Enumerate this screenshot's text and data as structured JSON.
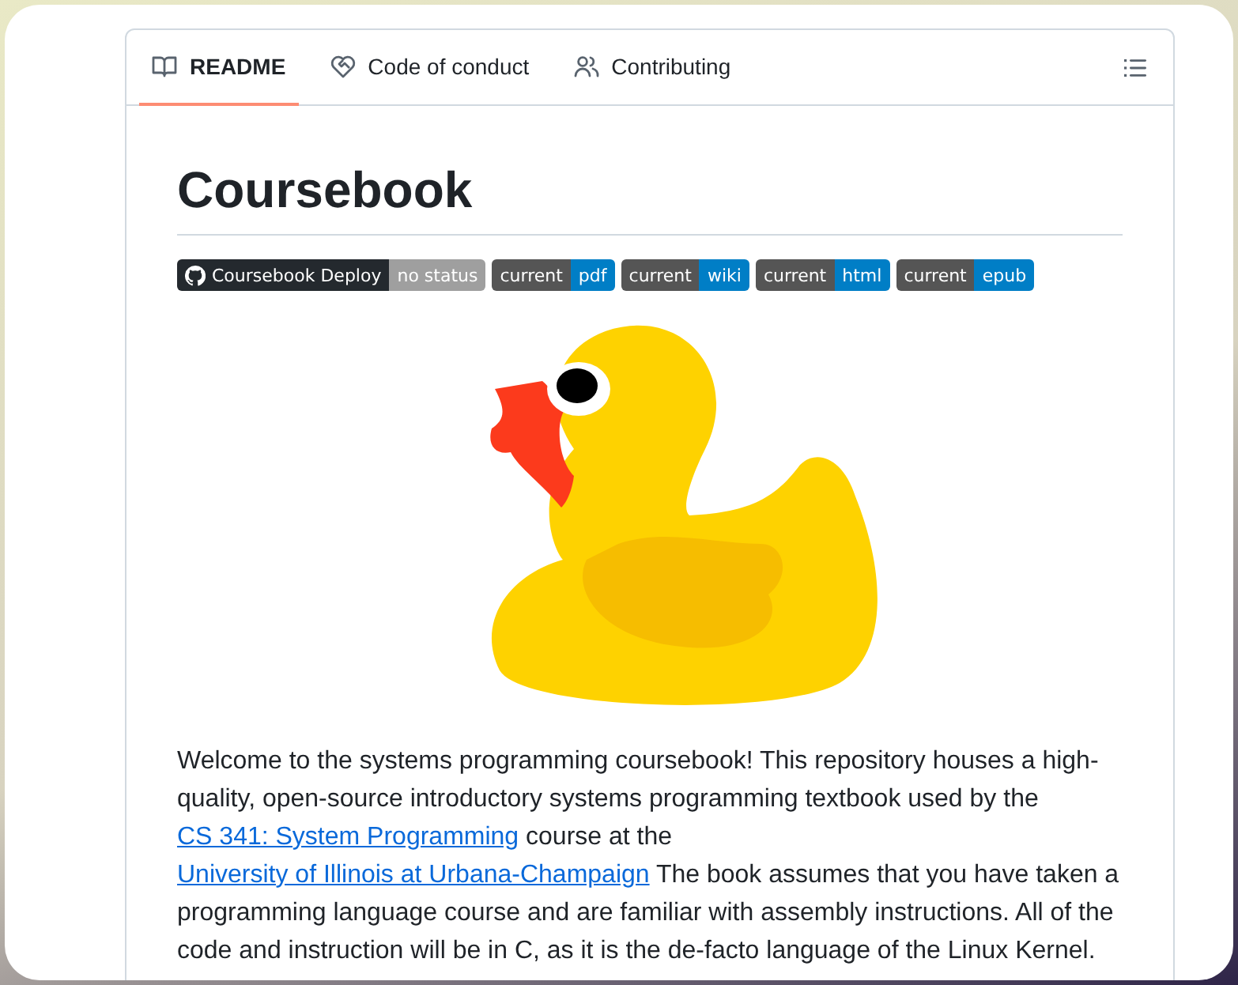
{
  "tabs": [
    {
      "label": "README",
      "kind": "book",
      "selected": true
    },
    {
      "label": "Code of conduct",
      "kind": "heart",
      "selected": false
    },
    {
      "label": "Contributing",
      "kind": "people",
      "selected": false
    }
  ],
  "title": "Coursebook",
  "badges": [
    {
      "label": "Coursebook Deploy",
      "message": "no status",
      "logo": true,
      "color": "#9f9f9f"
    },
    {
      "label": "current",
      "message": "pdf",
      "logo": false,
      "color": "#007ec6"
    },
    {
      "label": "current",
      "message": "wiki",
      "logo": false,
      "color": "#007ec6"
    },
    {
      "label": "current",
      "message": "html",
      "logo": false,
      "color": "#007ec6"
    },
    {
      "label": "current",
      "message": "epub",
      "logo": false,
      "color": "#007ec6"
    }
  ],
  "paragraph": [
    {
      "kind": "text",
      "text": "Welcome to the systems programming coursebook! This repository houses a high-quality, open-source introductory systems programming textbook used by the "
    },
    {
      "kind": "link",
      "text": "CS 341: System Programming"
    },
    {
      "kind": "text",
      "text": " course at the "
    },
    {
      "kind": "link",
      "text": "University of Illinois at Urbana-Champaign"
    },
    {
      "kind": "text",
      "text": " The book assumes that you have taken a programming language course and are familiar with assembly instructions. All of the code and instruction will be in C, as it is the de-facto language of the Linux Kernel."
    }
  ]
}
